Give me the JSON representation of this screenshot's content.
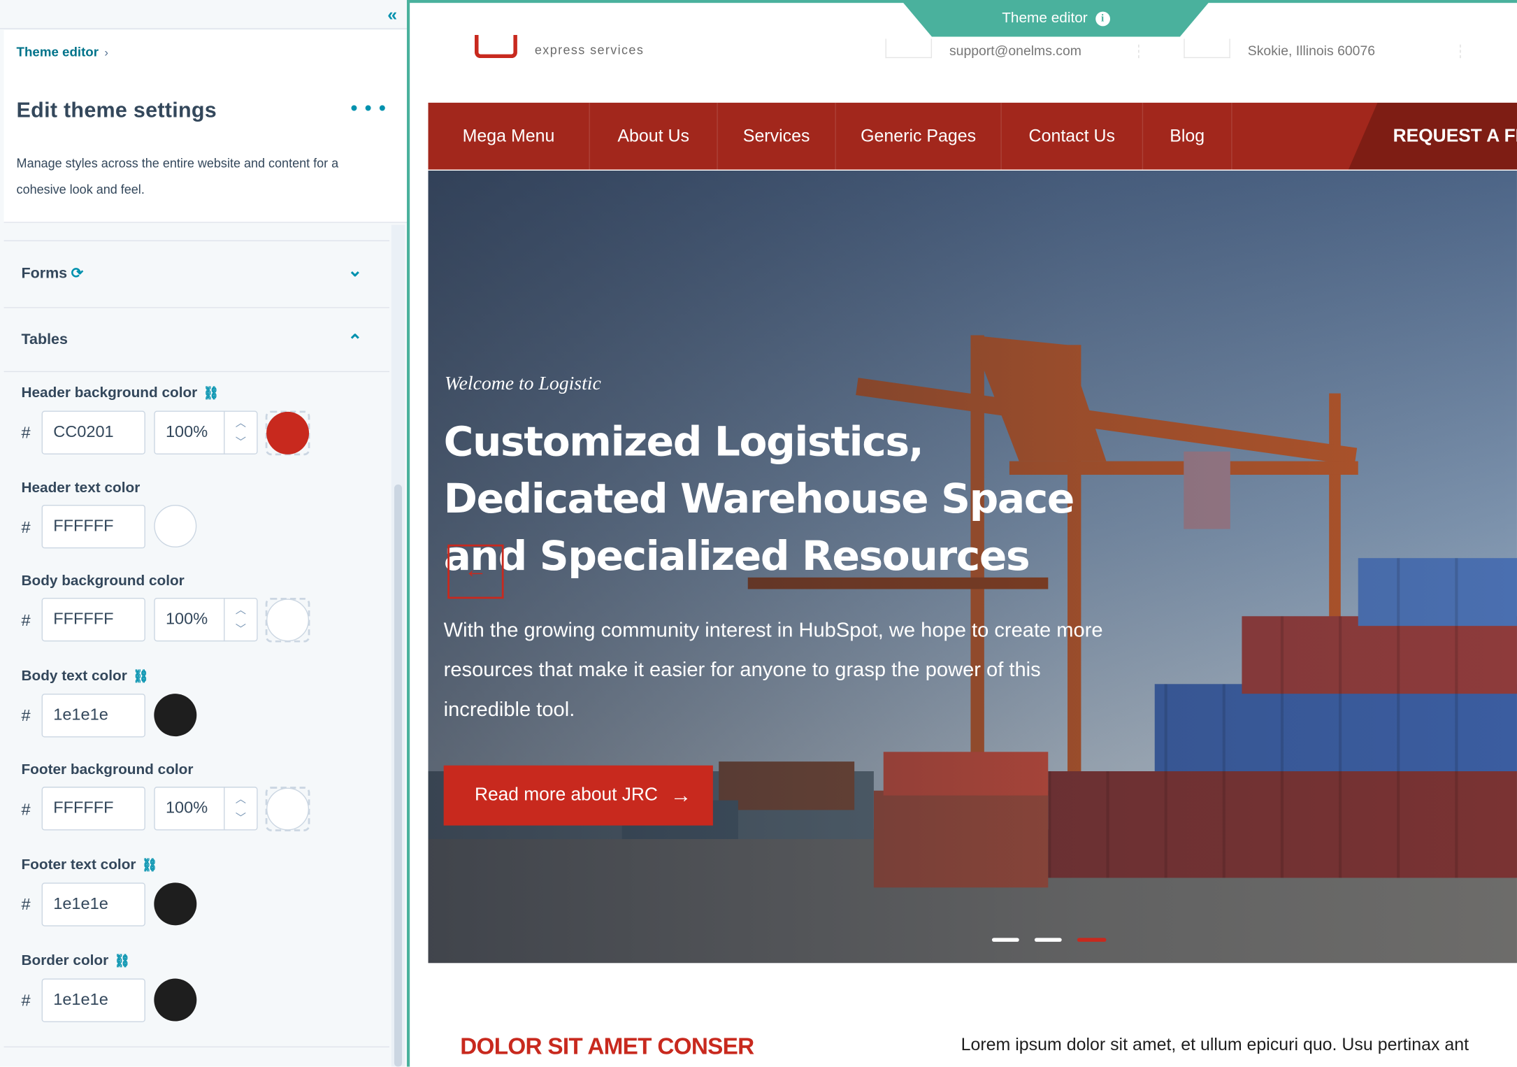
{
  "panel": {
    "breadcrumb": "Theme editor",
    "title": "Edit theme settings",
    "more_icon": "more-horizontal-icon",
    "description": "Manage styles across the entire website and content for a cohesive look and feel.",
    "sections": [
      {
        "label": "Forms",
        "expanded": false
      },
      {
        "label": "Tables",
        "expanded": true
      }
    ],
    "fields": [
      {
        "label": "Header background color",
        "linked": true,
        "hex": "CC0201",
        "opacity": "100%",
        "swatch": "#c8291e"
      },
      {
        "label": "Header text color",
        "linked": false,
        "hex": "FFFFFF",
        "swatch": "#ffffff"
      },
      {
        "label": "Body background color",
        "linked": false,
        "hex": "FFFFFF",
        "opacity": "100%",
        "swatch": "#ffffff"
      },
      {
        "label": "Body text color",
        "linked": true,
        "hex": "1e1e1e",
        "swatch": "#1e1e1e"
      },
      {
        "label": "Footer background color",
        "linked": false,
        "hex": "FFFFFF",
        "opacity": "100%",
        "swatch": "#ffffff"
      },
      {
        "label": "Footer text color",
        "linked": true,
        "hex": "1e1e1e",
        "swatch": "#1e1e1e"
      },
      {
        "label": "Border color",
        "linked": true,
        "hex": "1e1e1e",
        "swatch": "#1e1e1e"
      }
    ],
    "hash": "#"
  },
  "editor_tab": {
    "label": "Theme editor"
  },
  "site": {
    "tagline": "express services",
    "email": "support@onelms.com",
    "address": "Skokie, Illinois 60076",
    "nav": [
      "Mega Menu",
      "About Us",
      "Services",
      "Generic Pages",
      "Contact Us",
      "Blog"
    ],
    "cta": "REQUEST A FI",
    "hero": {
      "welcome": "Welcome to Logistic",
      "title": "Customized Logistics, Dedicated Warehouse Space and Specialized Resources",
      "body": "With the growing community interest in HubSpot, we hope to create more resources that make it easier for anyone to grasp the power of this incredible tool.",
      "button": "Read more about JRC",
      "active_slide": 3,
      "slide_count": 3
    },
    "section_title": "DOLOR SIT AMET CONSER",
    "section_body": "Lorem ipsum dolor sit amet, et ullum epicuri quo. Usu pertinax ant"
  },
  "colors": {
    "accent": "#0091ae",
    "frame": "#4ab19d",
    "brand_red": "#c8291e",
    "nav_red": "#a2271c"
  }
}
